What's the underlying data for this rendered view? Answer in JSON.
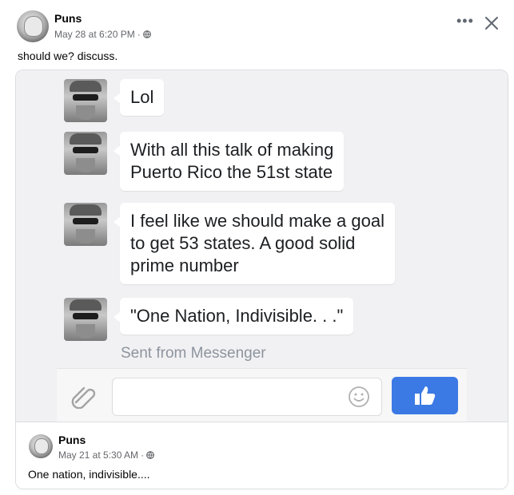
{
  "post": {
    "author": "Puns",
    "date": "May 28 at 6:20 PM",
    "separator": "·",
    "privacy_icon": "globe-icon",
    "caption": "should we? discuss.",
    "more_label": "•••",
    "close_icon": "close-icon"
  },
  "screenshot": {
    "messages": [
      {
        "lines": [
          "Lol"
        ]
      },
      {
        "lines": [
          "With all this talk of making",
          "Puerto Rico the 51st state"
        ]
      },
      {
        "lines": [
          "I feel like we should make a goal",
          "to get 53 states. A good solid",
          "prime number"
        ]
      },
      {
        "lines": [
          "\"One Nation, Indivisible. . .\""
        ]
      }
    ],
    "sent_from": "Sent from Messenger",
    "composer": {
      "attach_icon": "paperclip-icon",
      "emoji_icon": "smiley-icon",
      "like_icon": "thumbs-up-icon",
      "like_color": "#3b79e4"
    }
  },
  "original_post": {
    "author": "Puns",
    "date": "May 21 at 5:30 AM",
    "separator": "·",
    "privacy_icon": "globe-icon",
    "text": "One nation, indivisible...."
  }
}
